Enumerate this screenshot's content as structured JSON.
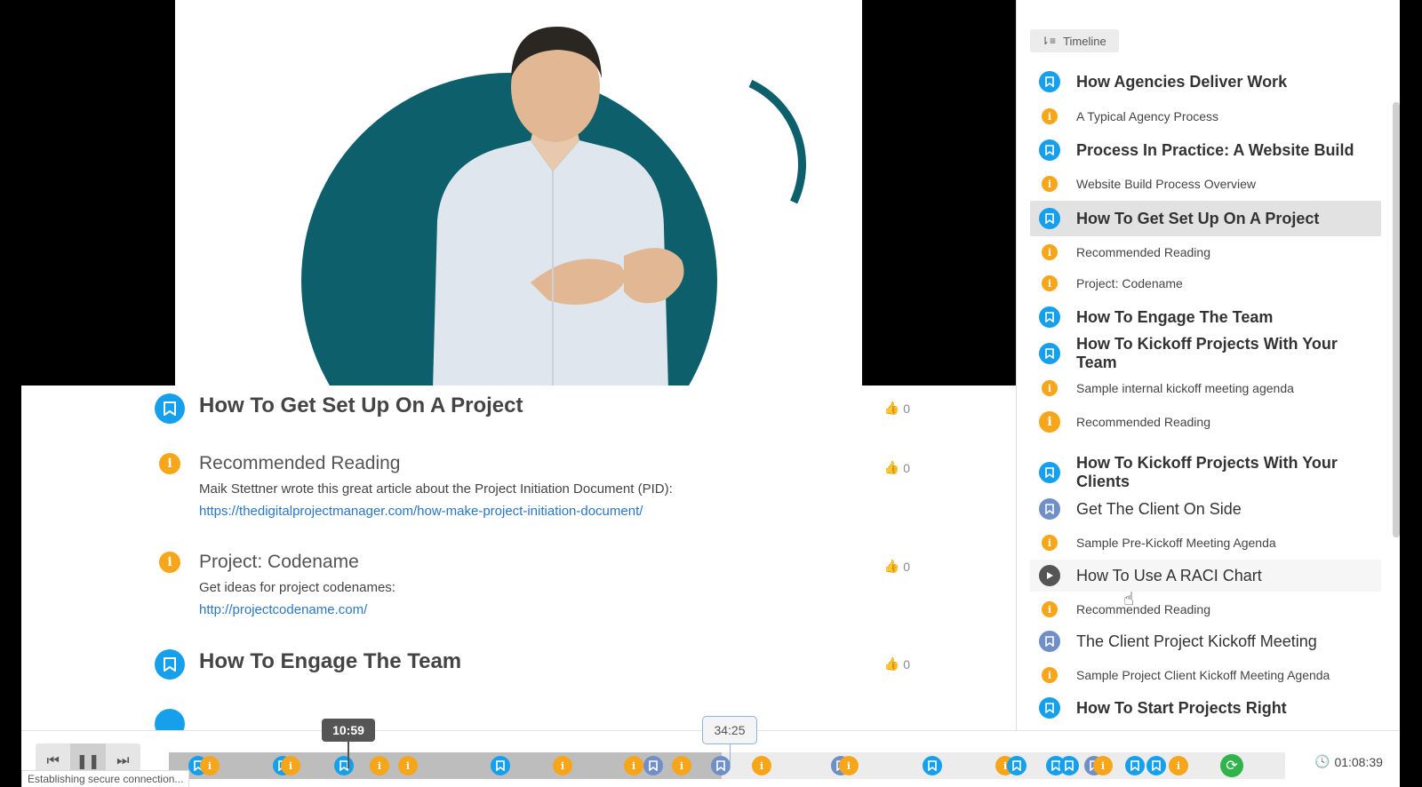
{
  "notes": [
    {
      "type": "chapter",
      "title": "How To Get Set Up On A Project",
      "likes": "0"
    },
    {
      "type": "info",
      "title": "Recommended Reading",
      "text": "Maik Stettner wrote this great article about the Project Initiation Document (PID):",
      "link": "https://thedigitalprojectmanager.com/how-make-project-initiation-document/",
      "likes": "0"
    },
    {
      "type": "info",
      "title": "Project: Codename",
      "text": "Get ideas for project codenames:",
      "link": "http://projectcodename.com/",
      "likes": "0"
    },
    {
      "type": "chapter",
      "title": "How To Engage The Team",
      "likes": "0"
    }
  ],
  "sidebar": {
    "timeline_label": "Timeline",
    "items": [
      {
        "kind": "chapter",
        "label": "How Agencies Deliver Work"
      },
      {
        "kind": "info",
        "label": "A Typical Agency Process"
      },
      {
        "kind": "chapter",
        "label": "Process In Practice: A Website Build"
      },
      {
        "kind": "info",
        "label": "Website Build Process Overview"
      },
      {
        "kind": "chapter",
        "label": "How To Get Set Up On A Project"
      },
      {
        "kind": "info",
        "label": "Recommended Reading"
      },
      {
        "kind": "info",
        "label": "Project: Codename"
      },
      {
        "kind": "chapter",
        "label": "How To Engage The Team"
      },
      {
        "kind": "chapter",
        "label": "How To Kickoff Projects With Your Team"
      },
      {
        "kind": "info",
        "label": "Sample internal kickoff meeting agenda"
      },
      {
        "kind": "info",
        "label": "Recommended Reading"
      },
      {
        "kind": "chapter",
        "label": "How To Kickoff Projects With Your Clients"
      },
      {
        "kind": "section",
        "label": "Get The Client On Side"
      },
      {
        "kind": "info",
        "label": "Sample Pre-Kickoff Meeting Agenda"
      },
      {
        "kind": "video",
        "label": "How To Use A RACI Chart"
      },
      {
        "kind": "info",
        "label": "Recommended Reading"
      },
      {
        "kind": "section",
        "label": "The Client Project Kickoff Meeting"
      },
      {
        "kind": "info",
        "label": "Sample Project Client Kickoff Meeting Agenda"
      },
      {
        "kind": "chapter",
        "label": "How To Start Projects Right"
      }
    ]
  },
  "player": {
    "current_time": "10:59",
    "hover_time": "34:25",
    "duration": "01:08:39",
    "progress_fraction": 0.495
  },
  "status_text": "Establishing secure connection...",
  "colors": {
    "chapter": "#16a0ec",
    "info": "#f7a51a",
    "section": "#6f8fc6",
    "video": "#555555",
    "teal": "#0d5f6b",
    "link": "#2a76c4"
  }
}
